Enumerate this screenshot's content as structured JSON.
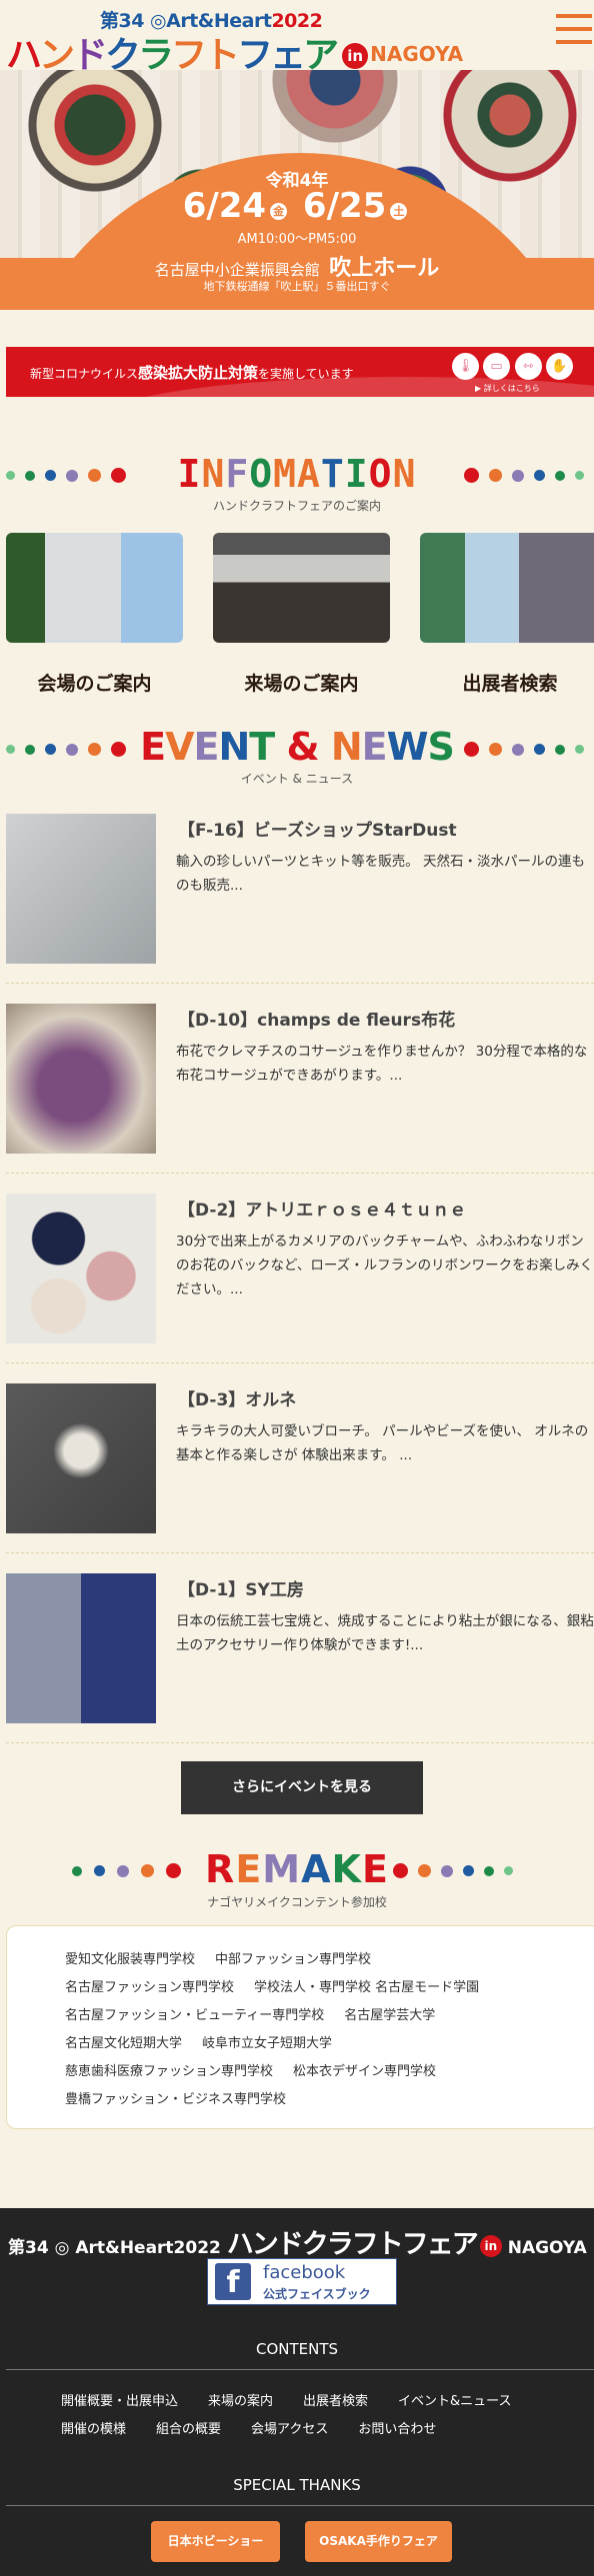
{
  "header": {
    "logo_sub": [
      {
        "t": "第34 ◎Art&Heart",
        "c": "#1f5ba0"
      },
      {
        "t": "2022",
        "c": "#d7141c"
      }
    ],
    "logo_main": [
      {
        "t": "ハ",
        "c": "#d7141c"
      },
      {
        "t": "ン",
        "c": "#e8722e"
      },
      {
        "t": "ド",
        "c": "#7b3fa0"
      },
      {
        "t": "ク",
        "c": "#1f5ba0"
      },
      {
        "t": "ラ",
        "c": "#1d8a4a"
      },
      {
        "t": "フ",
        "c": "#e8722e"
      },
      {
        "t": "ト",
        "c": "#e8722e"
      },
      {
        "t": "フ",
        "c": "#1f5ba0"
      },
      {
        "t": "ェ",
        "c": "#1f5ba0"
      },
      {
        "t": "ア",
        "c": "#1d8a4a"
      }
    ],
    "logo_in": "in",
    "logo_nagoya": "NAGOYA",
    "menu_icon": "hamburger-icon"
  },
  "hero": {
    "era": "令和4年",
    "date1": "6/24",
    "day1": "金",
    "date2": "6/25",
    "day2": "土",
    "time": "AM10:00〜PM5:00",
    "venue": "名古屋中小企業振興会館",
    "hall": "吹上ホール",
    "access": "地下鉄桜通線「吹上駅」５番出口すぐ"
  },
  "corona": {
    "pre": "新型コロナウイルス",
    "bold": "感染拡大防止対策",
    "post": "を実施しています",
    "more": "▶ 詳しくはこちら",
    "icons": [
      "thermometer-icon",
      "mask-icon",
      "distance-icon",
      "sanitizer-icon"
    ]
  },
  "info": {
    "title": [
      {
        "t": "I",
        "c": "#d7141c"
      },
      {
        "t": "N",
        "c": "#e8722e"
      },
      {
        "t": "F",
        "c": "#8b7bb5"
      },
      {
        "t": "O",
        "c": "#1d8a4a"
      },
      {
        "t": "M",
        "c": "#e8722e"
      },
      {
        "t": "A",
        "c": "#e8722e"
      },
      {
        "t": "T",
        "c": "#1f5ba0"
      },
      {
        "t": "I",
        "c": "#1d8a4a"
      },
      {
        "t": "O",
        "c": "#d7141c"
      },
      {
        "t": "N",
        "c": "#e8722e"
      }
    ],
    "subtitle": "ハンドクラフトフェアのご案内",
    "cards": [
      {
        "label": "会場のご案内"
      },
      {
        "label": "来場のご案内"
      },
      {
        "label": "出展者検索"
      }
    ]
  },
  "events": {
    "title": [
      {
        "t": "E",
        "c": "#d7141c"
      },
      {
        "t": "V",
        "c": "#e8722e"
      },
      {
        "t": "E",
        "c": "#8b7bb5"
      },
      {
        "t": "N",
        "c": "#1f5ba0"
      },
      {
        "t": "T",
        "c": "#1d8a4a"
      },
      {
        "t": " ",
        "c": "#333"
      },
      {
        "t": "&",
        "c": "#d7141c"
      },
      {
        "t": " ",
        "c": "#333"
      },
      {
        "t": "N",
        "c": "#e8722e"
      },
      {
        "t": "E",
        "c": "#8b7bb5"
      },
      {
        "t": "W",
        "c": "#1f5ba0"
      },
      {
        "t": "S",
        "c": "#1d8a4a"
      }
    ],
    "subtitle": "イベント & ニュース",
    "items": [
      {
        "title": "【F-16】ビーズショップStarDust",
        "desc": "輸入の珍しいパーツとキット等を販売。 天然石・淡水パールの連ものも販売..."
      },
      {
        "title": "【D-10】champs de fleurs布花",
        "desc": "布花でクレマチスのコサージュを作りませんか？ 30分程で本格的な布花コサージュができあがります。..."
      },
      {
        "title": "【D-2】アトリエｒｏｓｅ４ｔｕｎｅ",
        "desc": "30分で出来上がるカメリアのバックチャームや、ふわふわなリボンのお花のバックなど、ローズ・ルフランのリボンワークをお楽しみください。..."
      },
      {
        "title": "【D-3】オルネ",
        "desc": "キラキラの大人可愛いブローチ。 パールやビーズを使い、 オルネの基本と作る楽しさが 体験出来ます。 ..."
      },
      {
        "title": "【D-1】SY工房",
        "desc": "日本の伝統工芸七宝焼と、焼成することにより粘土が銀になる、銀粘土のアクセサリー作り体験ができます!..."
      }
    ],
    "more_label": "さらにイベントを見る"
  },
  "remake": {
    "title": [
      {
        "t": "R",
        "c": "#d7141c"
      },
      {
        "t": "E",
        "c": "#e8722e"
      },
      {
        "t": "M",
        "c": "#8b7bb5"
      },
      {
        "t": "A",
        "c": "#1f5ba0"
      },
      {
        "t": "K",
        "c": "#1d8a4a"
      },
      {
        "t": "E",
        "c": "#d7141c"
      }
    ],
    "subtitle": "ナゴヤリメイクコンテント参加校",
    "rows": [
      [
        "愛知文化服装専門学校",
        "中部ファッション専門学校"
      ],
      [
        "名古屋ファッション専門学校",
        "学校法人・専門学校 名古屋モード学園"
      ],
      [
        "名古屋ファッション・ビューティー専門学校",
        "名古屋学芸大学"
      ],
      [
        "名古屋文化短期大学",
        "岐阜市立女子短期大学"
      ],
      [
        "慈恵歯科医療ファッション専門学校",
        "松本衣デザイン専門学校"
      ],
      [
        "豊橋ファッション・ビジネス専門学校"
      ]
    ]
  },
  "footer": {
    "logo_sub": "第34 ◎ Art&Heart2022",
    "logo_main": "ハンドクラフトフェア",
    "logo_in": "in",
    "logo_nagoya": "NAGOYA",
    "fb_title": "facebook",
    "fb_sub": "公式フェイスブック",
    "contents_heading": "CONTENTS",
    "links": [
      [
        "開催概要・出展申込",
        "来場の案内",
        "出展者検索",
        "イベント&ニュース"
      ],
      [
        "開催の模様",
        "組合の概要",
        "会場アクセス",
        "お問い合わせ"
      ]
    ],
    "thanks_heading": "SPECIAL THANKS",
    "thanks": [
      "日本ホビーショー",
      "OSAKA手作りフェア"
    ]
  },
  "colors": {
    "bg": "#f7f2e4",
    "orange": "#ef8440",
    "red": "#d7141c",
    "dark": "#242424"
  }
}
